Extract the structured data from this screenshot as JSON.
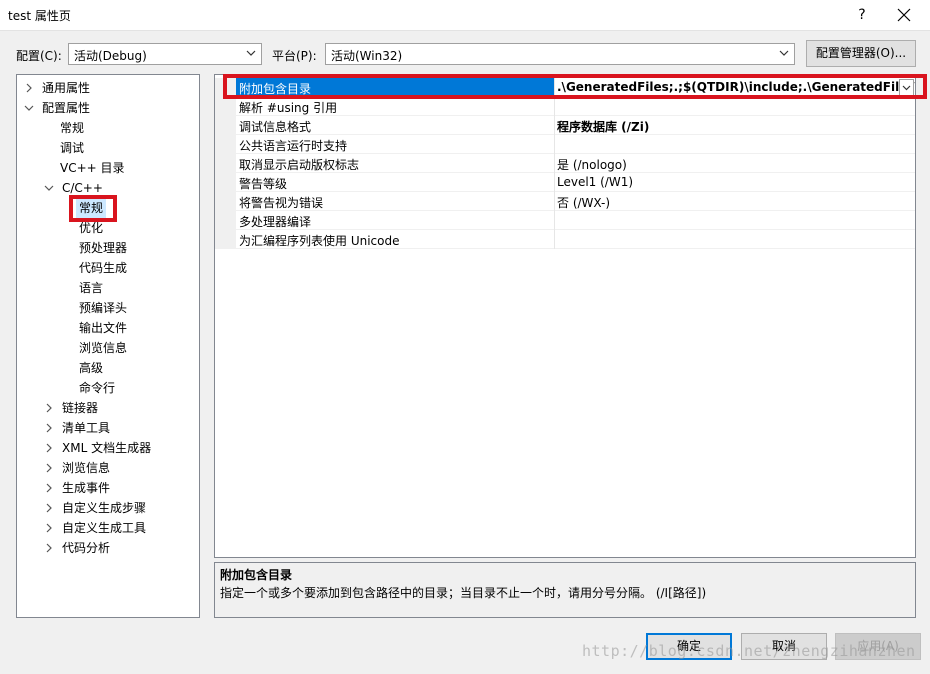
{
  "window": {
    "title": "test 属性页",
    "help": "?",
    "close": "✕"
  },
  "toolbar": {
    "config_label": "配置(C):",
    "config_value": "活动(Debug)",
    "platform_label": "平台(P):",
    "platform_value": "活动(Win32)",
    "config_manager_label": "配置管理器(O)..."
  },
  "tree": {
    "items": [
      {
        "label": "通用属性",
        "chevron": "right"
      },
      {
        "label": "配置属性",
        "chevron": "down"
      },
      {
        "label": "常规",
        "chevron": "none"
      },
      {
        "label": "调试",
        "chevron": "none"
      },
      {
        "label": "VC++ 目录",
        "chevron": "none"
      },
      {
        "label": "C/C++",
        "chevron": "down"
      },
      {
        "label": "常规",
        "chevron": "none",
        "selected": true
      },
      {
        "label": "优化",
        "chevron": "none"
      },
      {
        "label": "预处理器",
        "chevron": "none"
      },
      {
        "label": "代码生成",
        "chevron": "none"
      },
      {
        "label": "语言",
        "chevron": "none"
      },
      {
        "label": "预编译头",
        "chevron": "none"
      },
      {
        "label": "输出文件",
        "chevron": "none"
      },
      {
        "label": "浏览信息",
        "chevron": "none"
      },
      {
        "label": "高级",
        "chevron": "none"
      },
      {
        "label": "命令行",
        "chevron": "none"
      },
      {
        "label": "链接器",
        "chevron": "right"
      },
      {
        "label": "清单工具",
        "chevron": "right"
      },
      {
        "label": "XML 文档生成器",
        "chevron": "right"
      },
      {
        "label": "浏览信息",
        "chevron": "right"
      },
      {
        "label": "生成事件",
        "chevron": "right"
      },
      {
        "label": "自定义生成步骤",
        "chevron": "right"
      },
      {
        "label": "自定义生成工具",
        "chevron": "right"
      },
      {
        "label": "代码分析",
        "chevron": "right"
      }
    ]
  },
  "grid": {
    "rows": [
      {
        "name": "附加包含目录",
        "value": ".\\GeneratedFiles;.;$(QTDIR)\\include;.\\GeneratedFiles\\$(C",
        "selected": true,
        "bold": true
      },
      {
        "name": "解析 #using 引用",
        "value": ""
      },
      {
        "name": "调试信息格式",
        "value": "程序数据库 (/Zi)",
        "bold": true
      },
      {
        "name": "公共语言运行时支持",
        "value": ""
      },
      {
        "name": "取消显示启动版权标志",
        "value": "是 (/nologo)"
      },
      {
        "name": "警告等级",
        "value": "Level1 (/W1)"
      },
      {
        "name": "将警告视为错误",
        "value": "否 (/WX-)"
      },
      {
        "name": "多处理器编译",
        "value": ""
      },
      {
        "name": "为汇编程序列表使用 Unicode",
        "value": ""
      }
    ]
  },
  "description": {
    "title": "附加包含目录",
    "text": "指定一个或多个要添加到包含路径中的目录；当目录不止一个时，请用分号分隔。     (/I[路径])"
  },
  "buttons": {
    "ok": "确定",
    "cancel": "取消",
    "apply": "应用(A)"
  },
  "watermark": "http://blog.csdn.net/zhengzihanzhen",
  "colors": {
    "highlight_red": "#d9141e",
    "selection_blue": "#0078d7"
  }
}
